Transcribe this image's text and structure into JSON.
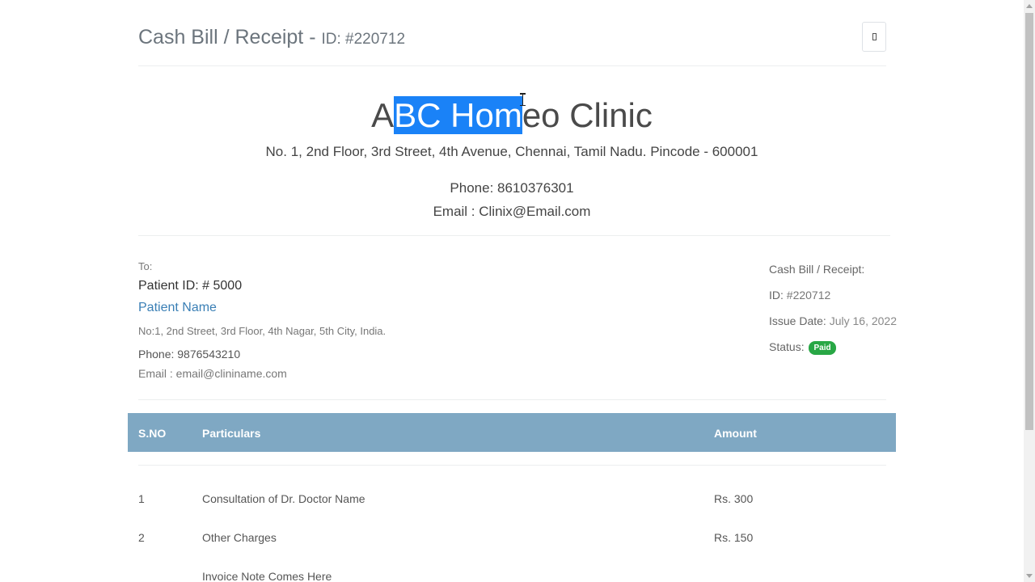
{
  "header": {
    "title": "Cash Bill / Receipt",
    "separator": "-",
    "id_text": "ID: #220712",
    "print_icon": "print-icon"
  },
  "clinic": {
    "name_before": "A",
    "name_selected": "BC Hom",
    "name_after": "eo Clinic",
    "address": "No. 1, 2nd Floor, 3rd Street, 4th Avenue, Chennai, Tamil Nadu. Pincode - 600001",
    "phone": "Phone: 8610376301",
    "email": "Email : Clinix@Email.com"
  },
  "patient": {
    "to_label": "To:",
    "id": "Patient ID: # 5000",
    "name": "Patient Name",
    "address": "No:1, 2nd Street, 3rd Floor, 4th Nagar, 5th City, India.",
    "phone_label": "Phone:",
    "phone": "9876543210",
    "email": "Email : email@clininame.com"
  },
  "bill": {
    "label": "Cash Bill / Receipt:",
    "id_label": "ID:",
    "id_value": "#220712",
    "issue_label": "Issue Date:",
    "issue_value": "July 16, 2022",
    "status_label": "Status:",
    "status_value": "Paid",
    "status_color": "#28a745"
  },
  "table": {
    "header_color": "#7fa8c3",
    "columns": [
      "S.NO",
      "Particulars",
      "Amount"
    ],
    "rows": [
      {
        "sno": "1",
        "particulars": "Consultation of Dr. Doctor Name",
        "amount": "Rs. 300"
      },
      {
        "sno": "2",
        "particulars": "Other Charges",
        "amount": "Rs. 150"
      }
    ],
    "note": "Invoice Note Comes Here"
  }
}
